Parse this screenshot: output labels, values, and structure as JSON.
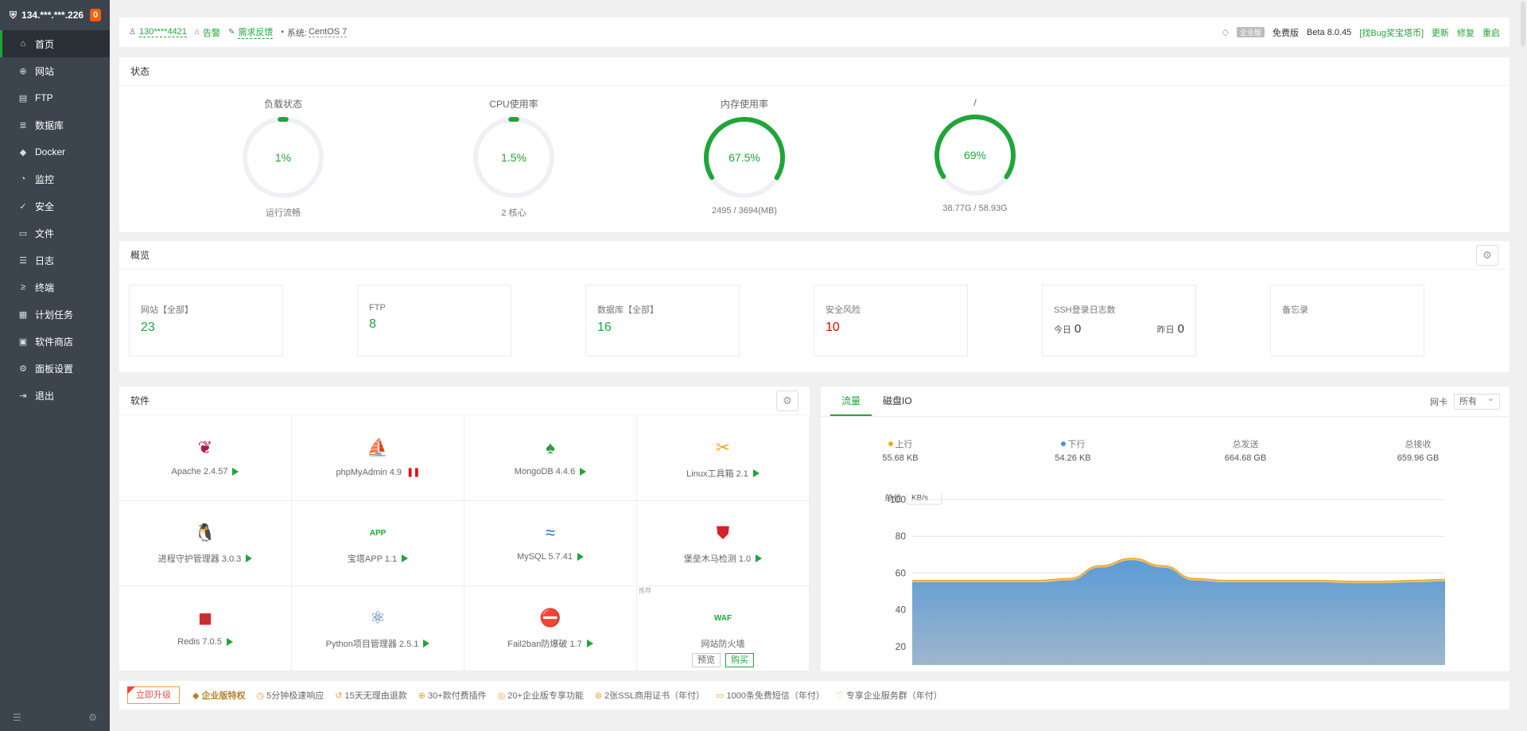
{
  "sidebar": {
    "server": "134.***.***.226",
    "badge": "0",
    "items": [
      {
        "label": "首页",
        "icon": "home-icon",
        "glyph": "⌂"
      },
      {
        "label": "网站",
        "icon": "globe-icon",
        "glyph": "⊕"
      },
      {
        "label": "FTP",
        "icon": "ftp-icon",
        "glyph": "▤"
      },
      {
        "label": "数据库",
        "icon": "database-icon",
        "glyph": "≣"
      },
      {
        "label": "Docker",
        "icon": "docker-icon",
        "glyph": "◆"
      },
      {
        "label": "监控",
        "icon": "monitor-icon",
        "glyph": "◔"
      },
      {
        "label": "安全",
        "icon": "shield-icon",
        "glyph": "✓"
      },
      {
        "label": "文件",
        "icon": "folder-icon",
        "glyph": "▭"
      },
      {
        "label": "日志",
        "icon": "log-icon",
        "glyph": "☰"
      },
      {
        "label": "终端",
        "icon": "terminal-icon",
        "glyph": "≥"
      },
      {
        "label": "计划任务",
        "icon": "calendar-icon",
        "glyph": "▦"
      },
      {
        "label": "软件商店",
        "icon": "store-icon",
        "glyph": "▣"
      },
      {
        "label": "面板设置",
        "icon": "settings-icon",
        "glyph": "⚙"
      },
      {
        "label": "退出",
        "icon": "logout-icon",
        "glyph": "⇥"
      }
    ]
  },
  "topbar": {
    "user": "130****4421",
    "alert": "告警",
    "feedback": "需求反馈",
    "system_prefix": "系统:",
    "system": "CentOS 7",
    "enterprise": "企业版",
    "edition": "免费版",
    "version": "Beta 8.0.45",
    "bug_reward": "[找Bug奖宝塔币]",
    "update": "更新",
    "repair": "修复",
    "restart": "重启"
  },
  "status": {
    "title": "状态",
    "gauges": [
      {
        "label": "负载状态",
        "value": "1%",
        "percent": 1,
        "sub": "运行流畅"
      },
      {
        "label": "CPU使用率",
        "value": "1.5%",
        "percent": 1.5,
        "sub": "2 核心"
      },
      {
        "label": "内存使用率",
        "value": "67.5%",
        "percent": 67.5,
        "sub": "2495 / 3694(MB)"
      },
      {
        "label": "/",
        "value": "69%",
        "percent": 69,
        "sub": "38.77G / 58.93G"
      }
    ]
  },
  "overview": {
    "title": "概览",
    "cards": [
      {
        "title": "网站【全部】",
        "value": "23"
      },
      {
        "title": "FTP",
        "value": "8"
      },
      {
        "title": "数据库【全部】",
        "value": "16"
      },
      {
        "title": "安全风险",
        "value": "10"
      },
      {
        "title": "SSH登录日志数",
        "today_label": "今日",
        "today": "0",
        "yesterday_label": "昨日",
        "yesterday": "0"
      },
      {
        "title": "备忘录"
      }
    ]
  },
  "software": {
    "title": "软件",
    "items": [
      {
        "name": "Apache 2.4.57",
        "icon": "apache-feather-icon",
        "glyph": "❦",
        "color": "#b3174f",
        "state": "running"
      },
      {
        "name": "phpMyAdmin 4.9",
        "icon": "phpmyadmin-icon",
        "glyph": "⛵",
        "color": "#e8a23f",
        "state": "paused"
      },
      {
        "name": "MongoDB 4.4.6",
        "icon": "mongodb-leaf-icon",
        "glyph": "♠",
        "color": "#2f9b49",
        "state": "running"
      },
      {
        "name": "Linux工具箱 2.1",
        "icon": "toolbox-icon",
        "glyph": "✂",
        "color": "#f0a81b",
        "state": "running"
      },
      {
        "name": "进程守护管理器 3.0.3",
        "icon": "linux-penguin-icon",
        "glyph": "🐧",
        "color": "#2671b5",
        "state": "running"
      },
      {
        "name": "宝塔APP 1.1",
        "icon": "app-icon",
        "glyph": "APP",
        "color": "#20a53a",
        "state": "running"
      },
      {
        "name": "MySQL 5.7.41",
        "icon": "mysql-dolphin-icon",
        "glyph": "≈",
        "color": "#2671b5",
        "state": "running"
      },
      {
        "name": "堡垒木马检测 1.0",
        "icon": "shield-scan-icon",
        "glyph": "⛊",
        "color": "#d6202a",
        "state": "running"
      },
      {
        "name": "Redis 7.0.5",
        "icon": "redis-icon",
        "glyph": "◼",
        "color": "#c9302c",
        "state": "running"
      },
      {
        "name": "Python项目管理器 2.5.1",
        "icon": "python-icon",
        "glyph": "⚛",
        "color": "#3a77b3",
        "state": "running"
      },
      {
        "name": "Fail2ban防爆破 1.7",
        "icon": "fail2ban-icon",
        "glyph": "⛔",
        "color": "#d6202a",
        "state": "running"
      },
      {
        "name": "网站防火墙",
        "icon": "waf-icon",
        "glyph": "WAF",
        "color": "#20a53a",
        "state": "buy",
        "tag": "推荐",
        "preview": "预览",
        "buy": "购买"
      }
    ]
  },
  "traffic": {
    "tabs": [
      "流量",
      "磁盘IO"
    ],
    "nic_label": "网卡",
    "nic_value": "所有",
    "stats": [
      {
        "label": "上行",
        "value": "55.68 KB",
        "color": "#f0a81b"
      },
      {
        "label": "下行",
        "value": "54.26 KB",
        "color": "#4a90e2"
      },
      {
        "label": "总发送",
        "value": "664.68 GB"
      },
      {
        "label": "总接收",
        "value": "659.96 GB"
      }
    ],
    "unit_label": "单位",
    "unit_value": "KB/s"
  },
  "chart_data": {
    "type": "area",
    "ylim": [
      10,
      100
    ],
    "yticks": [
      20,
      40,
      60,
      80,
      100
    ],
    "series": [
      {
        "name": "上行",
        "color": "#f0a81b",
        "values": [
          56,
          56,
          56,
          56,
          56,
          57,
          64,
          68,
          64,
          57,
          56,
          56,
          56,
          56,
          55.5,
          55.5,
          56,
          56.5
        ]
      },
      {
        "name": "下行",
        "color": "#5b9bd5",
        "values": [
          55,
          55,
          55,
          55,
          55,
          56,
          63,
          67,
          63,
          56,
          55,
          55,
          55,
          55,
          54.5,
          54.5,
          55,
          55.5
        ]
      }
    ]
  },
  "promo": {
    "upgrade": "立即升级",
    "title": "企业版特权",
    "items": [
      "5分钟极速响应",
      "15天无理由退款",
      "30+款付费插件",
      "20+企业版专享功能",
      "2张SSL商用证书（年付）",
      "1000条免费短信（年付）",
      "专享企业服务群（年付）"
    ]
  }
}
